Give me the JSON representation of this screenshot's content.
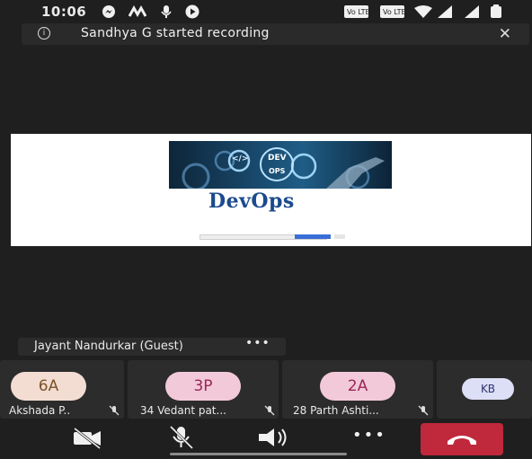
{
  "statusbar": {
    "time": "10:06"
  },
  "banner": {
    "text": "Sandhya G started recording"
  },
  "slide": {
    "title": "DevOps",
    "image_text_top": "DEV",
    "image_text_bottom": "OPS",
    "code_badge": "</>"
  },
  "active_speaker": {
    "name": "Jayant Nandurkar (Guest)",
    "more": "•••"
  },
  "participants": [
    {
      "initials": "6A",
      "name": "Akshada P..",
      "avatar_color": "#f3ddd3",
      "text_color": "#7b5226"
    },
    {
      "initials": "3P",
      "name": "34 Vedant pat...",
      "avatar_color": "#f2c9d9",
      "text_color": "#9c2654"
    },
    {
      "initials": "2A",
      "name": "28 Parth Ashti...",
      "avatar_color": "#f2c9d9",
      "text_color": "#9c2654"
    },
    {
      "initials": "KB",
      "name": "",
      "avatar_color": "#dcdff5",
      "text_color": "#2c336e"
    }
  ],
  "controls": {
    "more": "•••"
  },
  "colors": {
    "end_call": "#c0283c",
    "background": "#1f1f1f"
  }
}
